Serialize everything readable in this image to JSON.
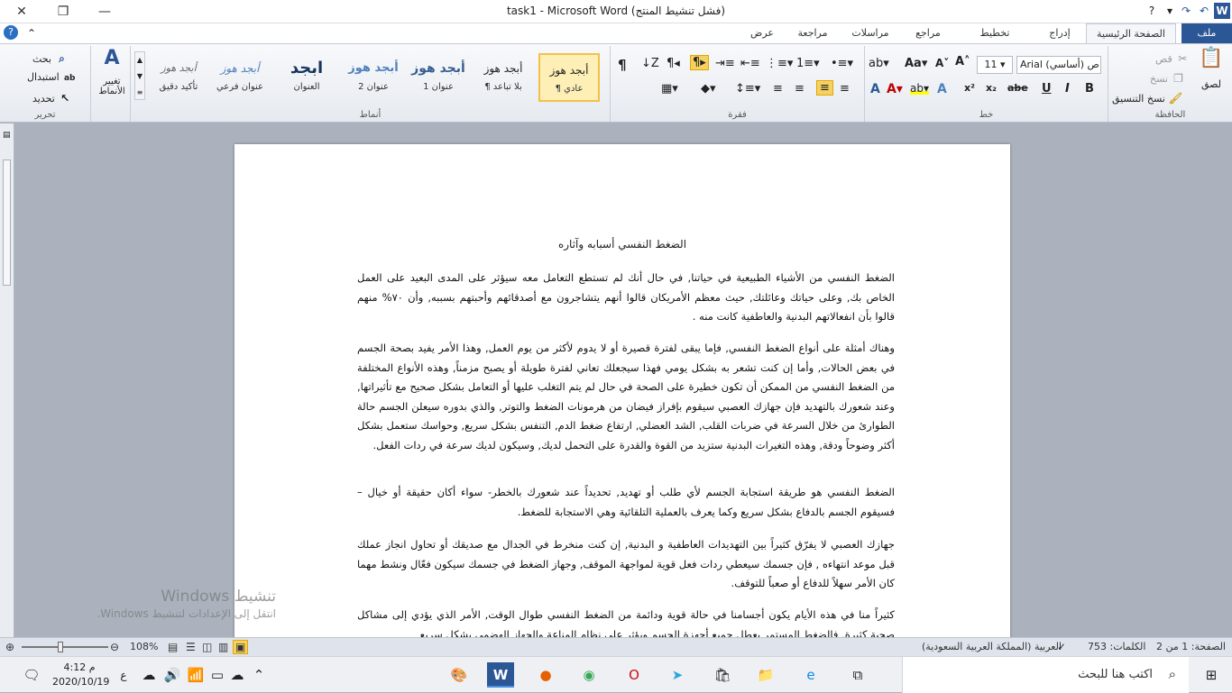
{
  "titlebar": {
    "title": "task1 - Microsoft Word (فشل تنشيط المنتج)",
    "close": "✕",
    "restore": "❐",
    "minimize": "—",
    "help": "?",
    "ribbon_min": "⌃"
  },
  "tabs": {
    "file": "ملف",
    "home": "الصفحة الرئيسية",
    "insert": "إدراج",
    "layout": "تخطيط الصفحة",
    "references": "مراجع",
    "mailings": "مراسلات",
    "review": "مراجعة",
    "view": "عرض"
  },
  "clipboard": {
    "paste": "لصق",
    "cut": "قص",
    "copy": "نسخ",
    "format_painter": "نسخ التنسيق",
    "label": "الحافظة"
  },
  "font": {
    "name": "Arial (أساسي) ص",
    "size": "11",
    "label": "خط",
    "bold": "B",
    "italic": "I",
    "underline": "U",
    "strike": "abe",
    "subscript": "x₂",
    "superscript": "x²",
    "grow": "A˄",
    "shrink": "A˅",
    "change_case": "Aa",
    "clear": "A"
  },
  "paragraph": {
    "label": "فقرة",
    "pilcrow": "¶"
  },
  "styles": {
    "label": "أنماط",
    "change_styles": "تغيير الأنماط",
    "items": [
      {
        "sample": "أبجد هوز",
        "name": "¶ عادي"
      },
      {
        "sample": "أبجد هوز",
        "name": "¶ بلا تباعد"
      },
      {
        "sample": "أبجد هوز",
        "name": "عنوان 1"
      },
      {
        "sample": "أبجد هوز",
        "name": "عنوان 2"
      },
      {
        "sample": "ابجد",
        "name": "العنوان"
      },
      {
        "sample": "أبجد هوز",
        "name": "عنوان فرعي"
      },
      {
        "sample": "أبجد هوز",
        "name": "تأكيد دقيق"
      }
    ]
  },
  "editing": {
    "find": "بحث",
    "replace": "استبدال",
    "select": "تحديد",
    "label": "تحرير"
  },
  "document": {
    "title": "الضغط النفسي أسبابه وآثاره",
    "paragraphs": [
      "الضغط النفسي من الأشياء الطبيعية في حياتنا, في حال أنك لم تستطع التعامل معه سيؤثر على المدى البعيد على العمل الخاص بك, وعلى حياتك وعائلتك, حيث معظم الأمريكان قالوا أنهم يتشاجرون مع أصدقائهم وأحبتهم بسببه, وأن ٧٠% منهم قالوا بأن انفعالاتهم البدنية والعاطفية كانت منه .",
      "وهناك أمثلة على أنواع الضغط النفسي, فإما يبقى لفترة قصيرة أو لا يدوم لأكثر من يوم العمل, وهذا الأمر يفيد بصحة الجسم في بعض الحالات, وأما إن كنت تشعر به بشكل يومي فهذا سيجعلك تعاني لفترة طويلة أو يصبح مزمناً, وهذه الأنواع المختلفة من الضغط النفسي من الممكن أن تكون خطيرة على الصحة في حال لم يتم التغلب عليها أو التعامل بشكل صحيح مع تأثيراتها, وعند شعورك بالتهديد فإن جهازك العصبي سيقوم بإفراز فيضان من هرمونات الضغط والتوتر, والذي بدوره سيعلن الجسم حالة الطوارئ من خلال السرعة في ضربات القلب, الشد العضلي, ارتفاع ضغط الدم, التنفس بشكل سريع, وحواسك ستعمل بشكل أكثر وضوحاً ودقة, وهذه التغيرات البدنية ستزيد من القوة والقدرة على التحمل لديك, وسيكون لديك سرعة في ردات الفعل.",
      "الضغط النفسي هو طريقة استجابة الجسم لأي طلب أو تهديد, تحديداً عند شعورك بالخطر- سواء أكان حقيقة أو خيال – فسيقوم الجسم بالدفاع بشكل سريع وكما يعرف بالعملية التلقائية وهي الاستجابة للضغط.",
      "جهازك العصبي لا يفرّق كثيراً بين التهديدات العاطفية و البدنية, إن كنت منخرط في الجدال مع صديقك أو تحاول انجاز عملك قبل موعد انتهاءه , فإن جسمك سيعطي ردات فعل قوية لمواجهة الموقف, وجهاز الضغط في جسمك سيكون فعّال ونشط مهما كان الأمر سهلاً للدفاع أو صعباً للتوقف.",
      "كثيراً منا في هذه الأيام يكون أجسامنا في حالة قوية ودائمة من الضغط النفسي طوال الوقت, الأمر الذي يؤدي إلى مشاكل صحية كثيرة, فالضغط المستمر يعطل جميع أجهزة الجسم ويؤثر على نظام المناعة والجهاز الهضمي بشكل سريع"
    ]
  },
  "watermark": {
    "line1": "تنشيط Windows",
    "line2": "انتقل إلى الإعدادات لتنشيط Windows."
  },
  "status": {
    "page": "الصفحة: 1 من 2",
    "words": "الكلمات: 753",
    "language": "العربية (المملكة العربية السعودية)",
    "zoom": "108%"
  },
  "taskbar": {
    "search_placeholder": "اكتب هنا للبحث",
    "time": "4:12 م",
    "date": "2020/10/19",
    "lang": "ع"
  }
}
